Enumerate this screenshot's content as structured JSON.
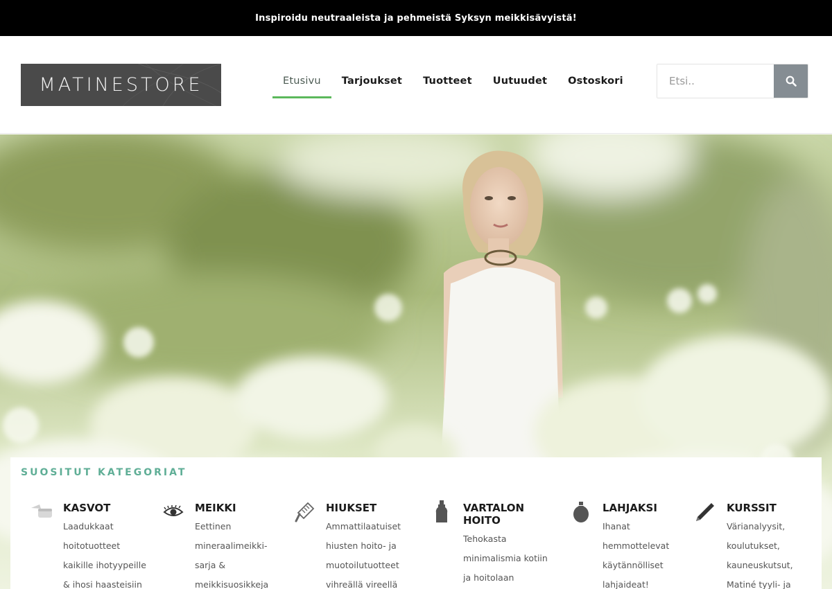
{
  "announcement": "Inspiroidu neutraaleista ja pehmeistä Syksyn meikkisävyistä!",
  "logo": {
    "text": "MATINESTORE"
  },
  "nav": {
    "items": [
      {
        "label": "Etusivu",
        "active": true
      },
      {
        "label": "Tarjoukset",
        "active": false
      },
      {
        "label": "Tuotteet",
        "active": false
      },
      {
        "label": "Uutuudet",
        "active": false
      },
      {
        "label": "Ostoskori",
        "active": false
      }
    ]
  },
  "search": {
    "placeholder": "Etsi..",
    "icon": "search-icon"
  },
  "colors": {
    "accent_green": "#5cb85c",
    "category_title": "#5fae96",
    "search_button": "#858d93",
    "topbar": "#000000"
  },
  "categories": {
    "title": "SUOSITUT KATEGORIAT",
    "items": [
      {
        "name": "KASVOT",
        "icon": "cream-jar-icon",
        "desc": "Laadukkaat hoitotuotteet kaikille ihotyypeille & ihosi haasteisiin"
      },
      {
        "name": "MEIKKI",
        "icon": "eye-icon",
        "desc": "Eettinen mineraalimeikki-sarja & meikkisuosikkeja"
      },
      {
        "name": "HIUKSET",
        "icon": "comb-icon",
        "desc": "Ammattilaatuiset hiusten hoito- ja muotoilutuotteet vihreällä vireellä"
      },
      {
        "name": "VARTALON HOITO",
        "icon": "lotion-bottle-icon",
        "desc": "Tehokasta minimalismia kotiin ja hoitolaan"
      },
      {
        "name": "LAHJAKSI",
        "icon": "perfume-bottle-icon",
        "desc": "Ihanat hemmottelevat käytännölliset lahjaideat!"
      },
      {
        "name": "KURSSIT",
        "icon": "pencil-icon",
        "desc": "Värianalyysit, koulutukset, kauneuskutsut, Matiné tyyli- ja"
      }
    ]
  }
}
